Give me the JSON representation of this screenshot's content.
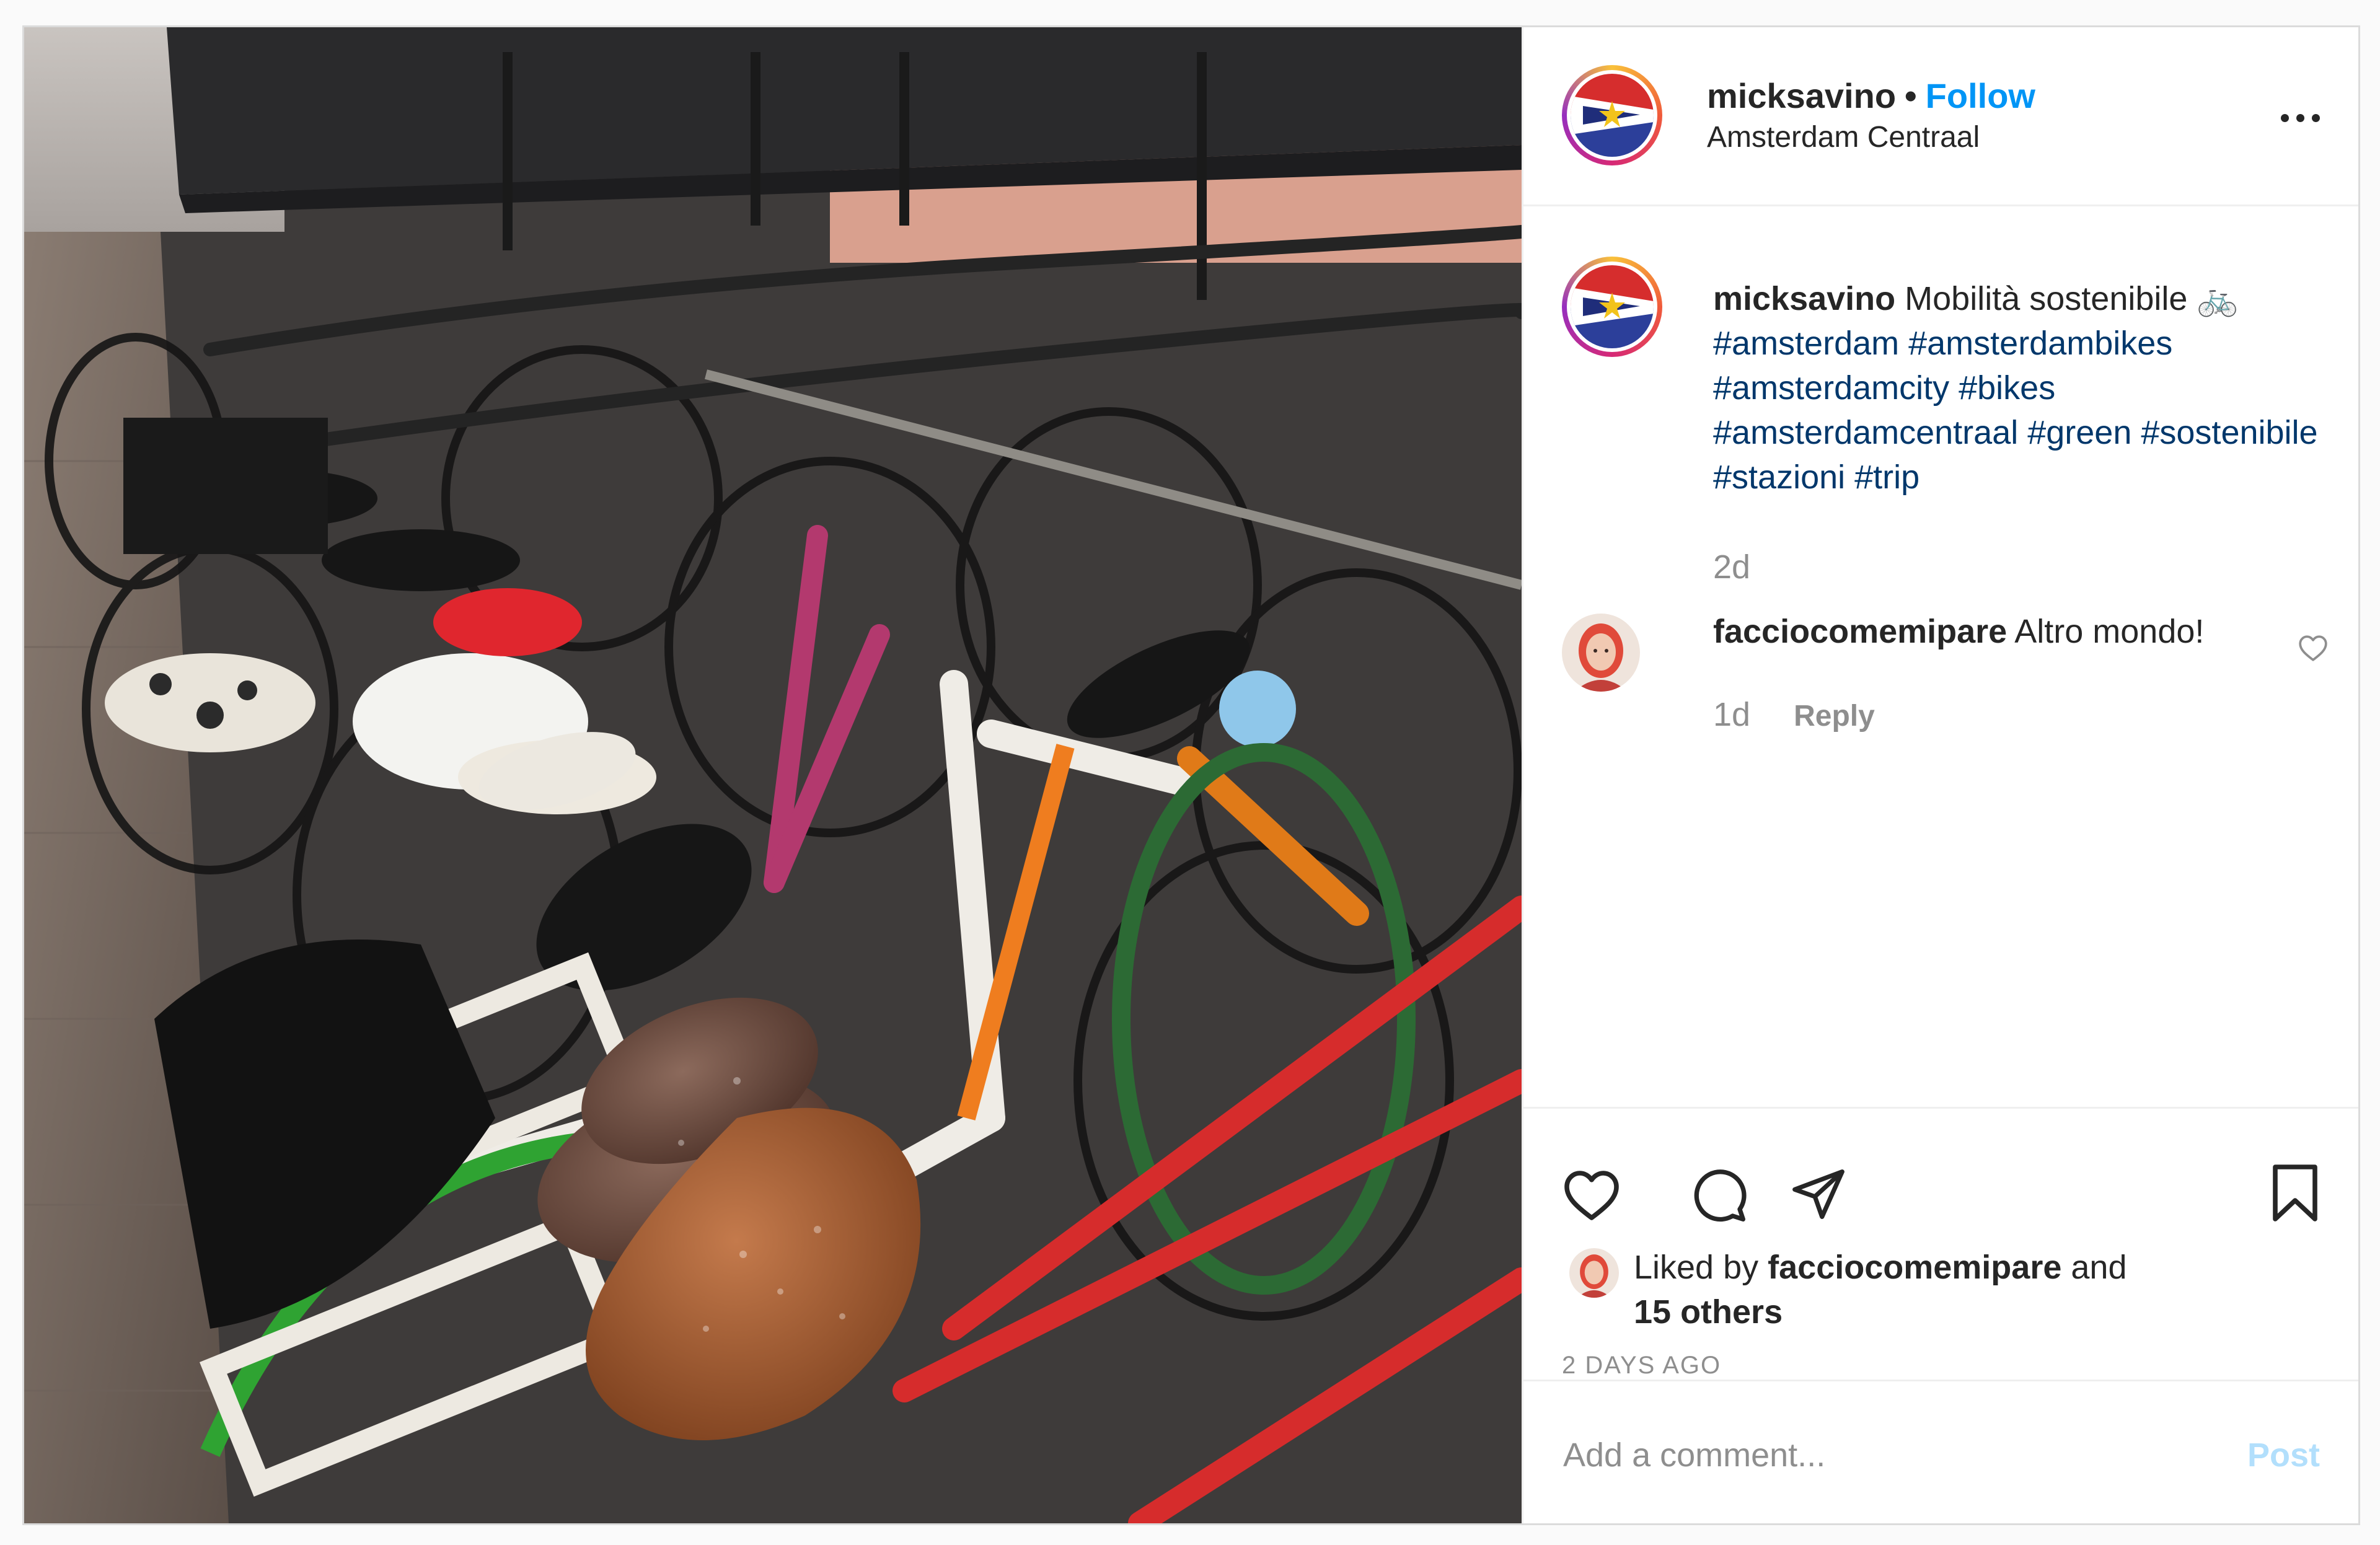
{
  "post": {
    "username": "micksavino",
    "separator": "•",
    "follow_label": "Follow",
    "location": "Amsterdam Centraal",
    "more_icon": "more-horizontal-icon"
  },
  "caption": {
    "username": "micksavino",
    "text": "Mobilità sostenibile 🚲",
    "hashtags": "#amsterdam #amsterdambikes #amsterdamcity #bikes #amsterdamcentraal #green #sostenibile #stazioni #trip",
    "time": "2d"
  },
  "comments": [
    {
      "username": "facciocomemipare",
      "text": "Altro mondo!",
      "time": "1d",
      "reply_label": "Reply"
    }
  ],
  "actions": {
    "icons": [
      "heart-icon",
      "comment-icon",
      "share-icon",
      "bookmark-icon"
    ]
  },
  "likes": {
    "prefix": "Liked by",
    "user": "facciocomemipare",
    "and": "and",
    "others": "15 others"
  },
  "date_label": "2 DAYS AGO",
  "add_comment": {
    "placeholder": "Add a comment...",
    "post_label": "Post"
  },
  "colors": {
    "link_blue": "#0095f6",
    "hashtag_blue": "#00376b",
    "post_disabled": "#b2dffc",
    "secondary_text": "#8e8e8e"
  }
}
